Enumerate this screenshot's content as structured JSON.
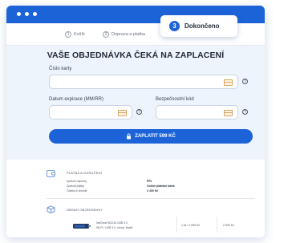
{
  "steps": [
    {
      "number": "1",
      "label": "Košík"
    },
    {
      "number": "2",
      "label": "Doprava a platba"
    },
    {
      "number": "3",
      "label": "Dokončeno"
    }
  ],
  "page_title": "VAŠE OBJEDNÁVKA ČEKÁ NA ZAPLACENÍ",
  "form": {
    "card_number_label": "Číslo karty",
    "expiry_label": "Datum expirace (MM/RR)",
    "security_code_label": "Bezpečnostní kód",
    "help_glyph": "?"
  },
  "pay_button_label": "ZAPLATIT 599 KČ",
  "summary": {
    "payment_section_title": "PLATBA A DORUČENÍ",
    "payment_rows": [
      {
        "key": "Způsob dopravy",
        "value": "PPL"
      },
      {
        "key": "Způsob platby",
        "value": "Online platební karta"
      },
      {
        "key": "Částka k úhradě",
        "value": "2 400 Kč"
      }
    ],
    "order_section_title": "OBSAH OBJEDNÁVKY",
    "product": {
      "name_line1": "NetGear BG234 USB 3.0",
      "name_line2": "Wi-Fi / USB 3.0, černá, Mobil",
      "quantity": "1 ks / 2 599 Kč",
      "price": "2 599 Kč"
    }
  },
  "colors": {
    "accent": "#1d63d8",
    "content_bg": "#eef4fb",
    "card_icon": "#e0a15b"
  },
  "icons": [
    "card-icon",
    "help-icon",
    "lock-icon",
    "wallet-icon",
    "box-icon"
  ]
}
